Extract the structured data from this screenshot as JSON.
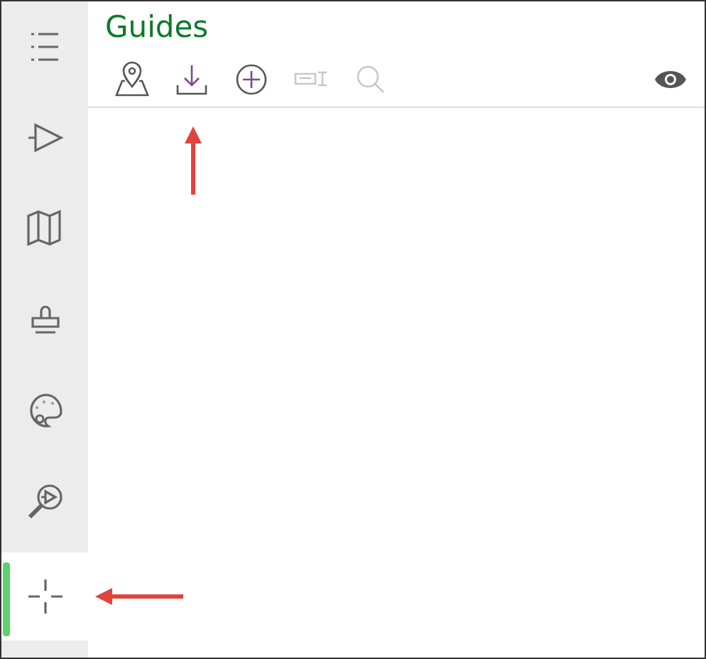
{
  "sidebar": {
    "items": [
      {
        "kind": "list",
        "selected": false
      },
      {
        "kind": "play",
        "selected": false
      },
      {
        "kind": "map",
        "selected": false
      },
      {
        "kind": "stamp",
        "selected": false
      },
      {
        "kind": "palette",
        "selected": false
      },
      {
        "kind": "zoom",
        "selected": false
      },
      {
        "kind": "crosshair",
        "selected": true
      }
    ]
  },
  "panel": {
    "title": "Guides",
    "tools": [
      {
        "kind": "map-pin",
        "disabled": false
      },
      {
        "kind": "download",
        "disabled": false
      },
      {
        "kind": "add",
        "disabled": false
      },
      {
        "kind": "tag",
        "disabled": true
      },
      {
        "kind": "search",
        "disabled": true
      }
    ],
    "visibility": {
      "kind": "eye"
    }
  }
}
